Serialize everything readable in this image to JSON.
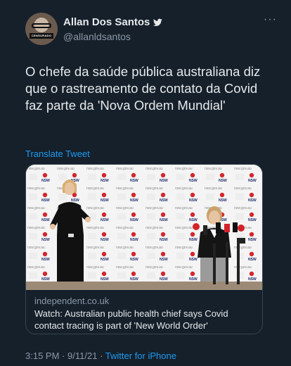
{
  "user": {
    "display_name": "Allan Dos Santos",
    "handle": "@allanldsantos",
    "avatar_badge": "CENSURADO",
    "verified": true
  },
  "tweet": {
    "text": "O chefe da saúde pública australiana diz que o rastreamento de contato da Covid faz parte da 'Nova Ordem Mundial'",
    "translate_label": "Translate Tweet"
  },
  "card": {
    "domain": "independent.co.uk",
    "title": "Watch: Australian public health chief says Covid contact tracing is part of 'New World Order'",
    "backdrop_text": "nsw.gov.au",
    "logo_text": "NSW"
  },
  "footer": {
    "time": "3:15 PM",
    "separator": "·",
    "date": "9/11/21",
    "source": "Twitter for iPhone"
  },
  "colors": {
    "background": "#15202b",
    "link": "#1d9bf0",
    "secondary": "#8b98a5",
    "border": "#38444d"
  },
  "icons": [
    "verified-bird-icon",
    "more-options-icon"
  ]
}
